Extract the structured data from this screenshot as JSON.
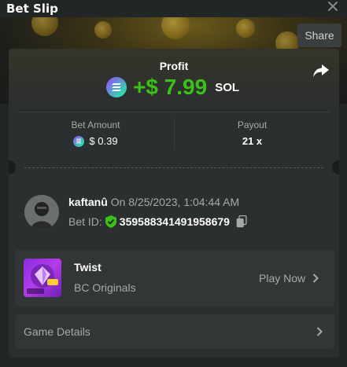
{
  "header": {
    "title": "Bet Slip",
    "close_icon": "close-icon"
  },
  "share_button": {
    "label": "Share"
  },
  "profit": {
    "label": "Profit",
    "value": "+$ 7.99",
    "currency": "SOL",
    "color": "#3bc117"
  },
  "stats": {
    "bet_amount": {
      "label": "Bet Amount",
      "value": "$ 0.39"
    },
    "payout": {
      "label": "Payout",
      "value": "21 x"
    }
  },
  "user": {
    "name": "kaftanû",
    "date_text": "On 8/25/2023, 1:04:44 AM",
    "bet_id_label": "Bet ID:",
    "bet_id": "359588341491958679"
  },
  "game": {
    "name": "Twist",
    "provider": "BC Originals",
    "play_label": "Play Now"
  },
  "details": {
    "label": "Game Details"
  }
}
